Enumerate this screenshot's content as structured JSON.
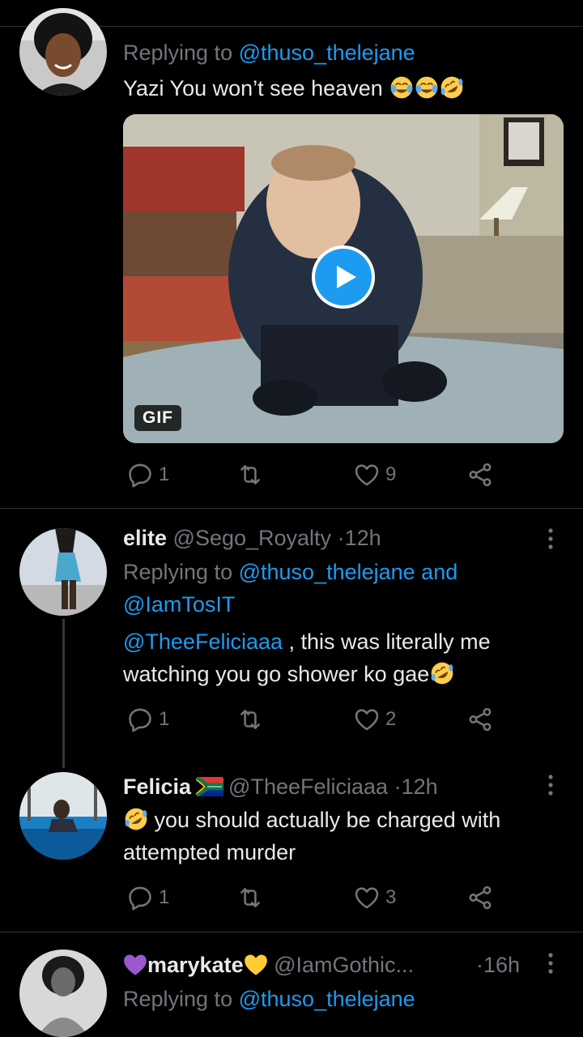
{
  "tweet1": {
    "replying_prefix": "Replying to",
    "replying_handle": "@thuso_thelejane",
    "text": "Yazi You won’t see heaven",
    "emoji_icons": [
      "face-with-tears-of-joy-icon",
      "face-with-tears-of-joy-icon",
      "rolling-on-floor-laughing-icon"
    ],
    "media": {
      "badge": "GIF",
      "play_icon": "play-icon"
    },
    "stats": {
      "replies": "1",
      "likes": "9"
    }
  },
  "tweet2": {
    "name": "elite",
    "handle": "@Sego_Royalty",
    "dot": "·",
    "time": "12h",
    "replying_prefix": "Replying to",
    "replying_handles": "@thuso_thelejane and",
    "replying_handles_2": "@IamTosIT",
    "mention": "@TheeFeliciaaa",
    "text_after_mention": " , this was literally me",
    "text_line2": "watching you go shower ko gae",
    "stats": {
      "replies": "1",
      "likes": "2"
    }
  },
  "tweet3": {
    "name": "Felicia",
    "handle": "@TheeFeliciaaa",
    "dot": "·",
    "time": "12h",
    "text_line1": " you should actually be charged with",
    "text_line2": "attempted murder",
    "stats": {
      "replies": "1",
      "likes": "3"
    }
  },
  "tweet4": {
    "name": "marykate",
    "handle": "@IamGothic...",
    "dot": "·",
    "time": "16h",
    "replying_prefix": "Replying to",
    "replying_handle": "@thuso_thelejane"
  },
  "colors": {
    "background": "#000000",
    "text": "#e7e9ea",
    "muted": "#71767b",
    "link": "#1d9bf0",
    "divider": "#2f3336",
    "heart_purple": "#9b59d0",
    "heart_yellow": "#ffcc33"
  }
}
